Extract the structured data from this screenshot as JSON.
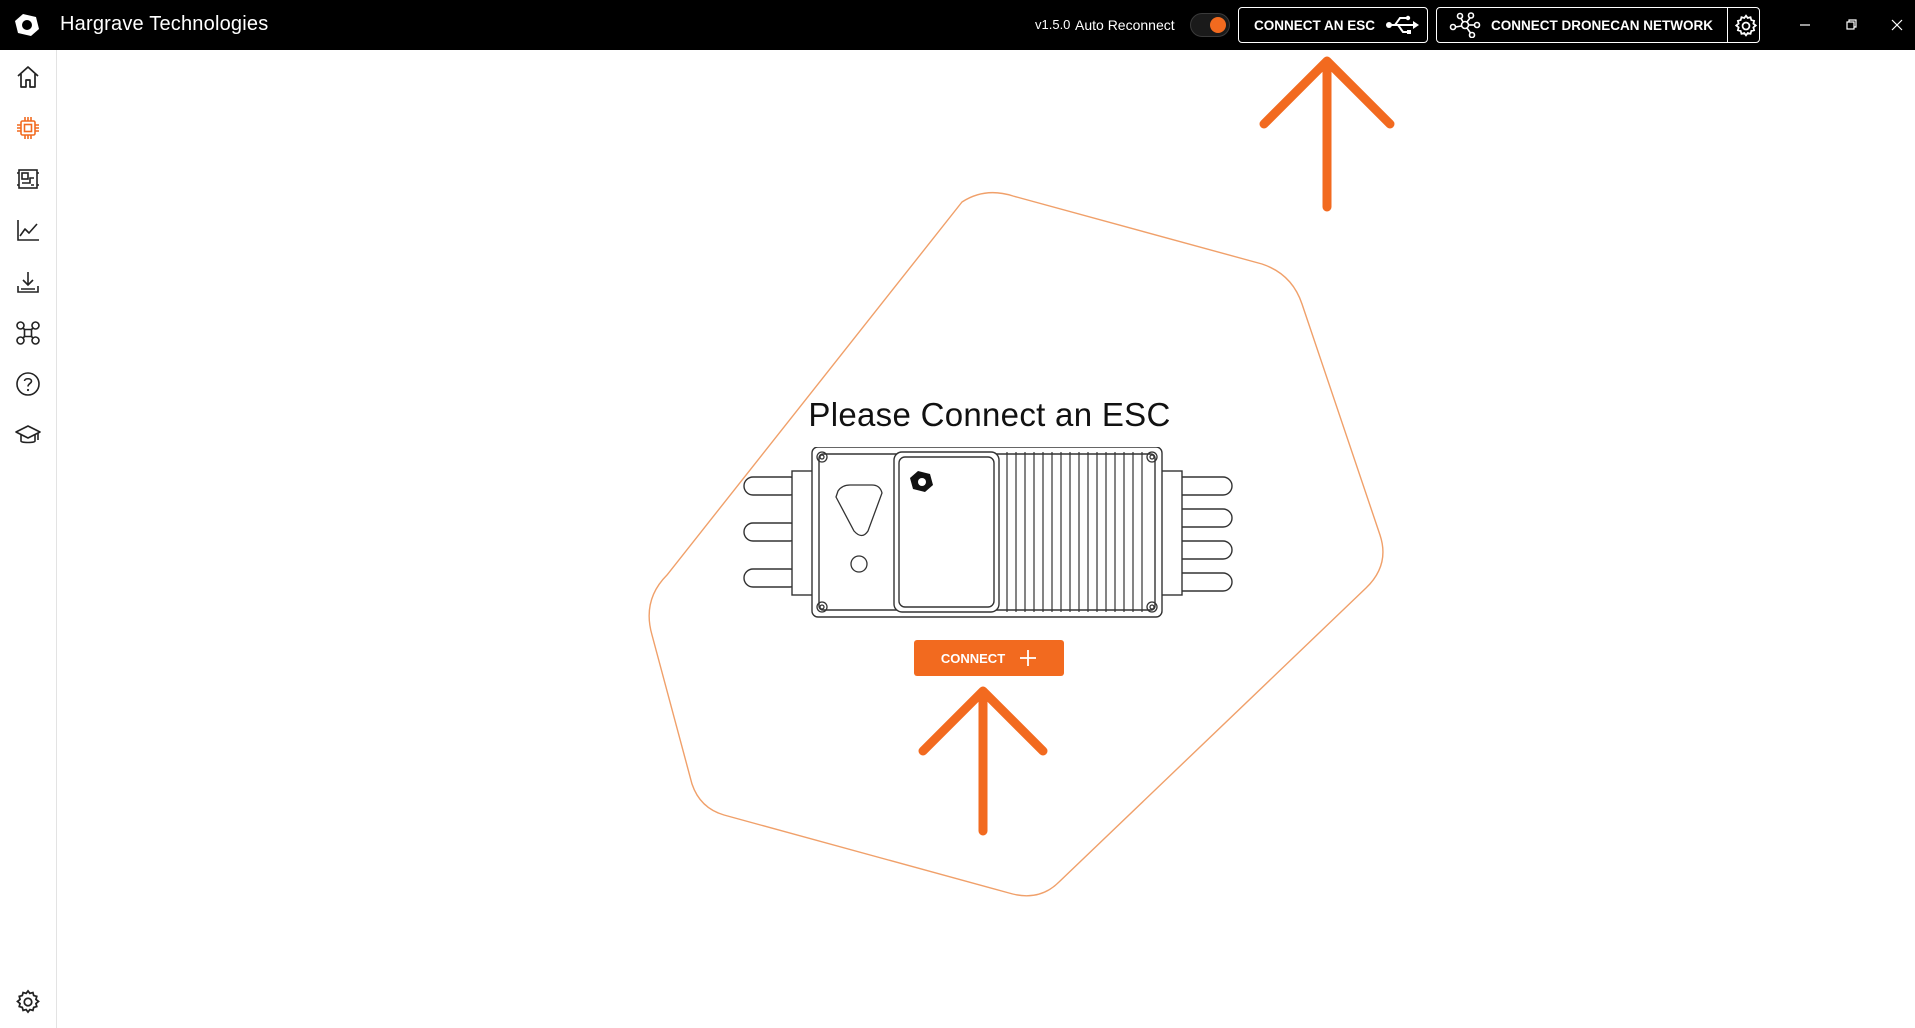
{
  "app": {
    "name": "Hargrave Technologies",
    "version": "v1.5.0"
  },
  "header": {
    "auto_reconnect_label": "Auto Reconnect",
    "auto_reconnect_on": true,
    "connect_esc_label": "CONNECT AN ESC",
    "connect_dronecan_label": "CONNECT DRONECAN NETWORK"
  },
  "sidebar": {
    "items": [
      {
        "icon": "home-icon"
      },
      {
        "icon": "chip-icon",
        "active": true
      },
      {
        "icon": "dashboard-icon"
      },
      {
        "icon": "chart-line-icon"
      },
      {
        "icon": "download-icon"
      },
      {
        "icon": "drone-icon"
      },
      {
        "icon": "help-icon"
      },
      {
        "icon": "graduation-cap-icon"
      }
    ],
    "footer_icon": "settings-icon"
  },
  "main": {
    "headline": "Please Connect an ESC",
    "connect_button_label": "CONNECT"
  },
  "colors": {
    "accent": "#f26a1f",
    "titlebar": "#000000",
    "background": "#ffffff"
  }
}
